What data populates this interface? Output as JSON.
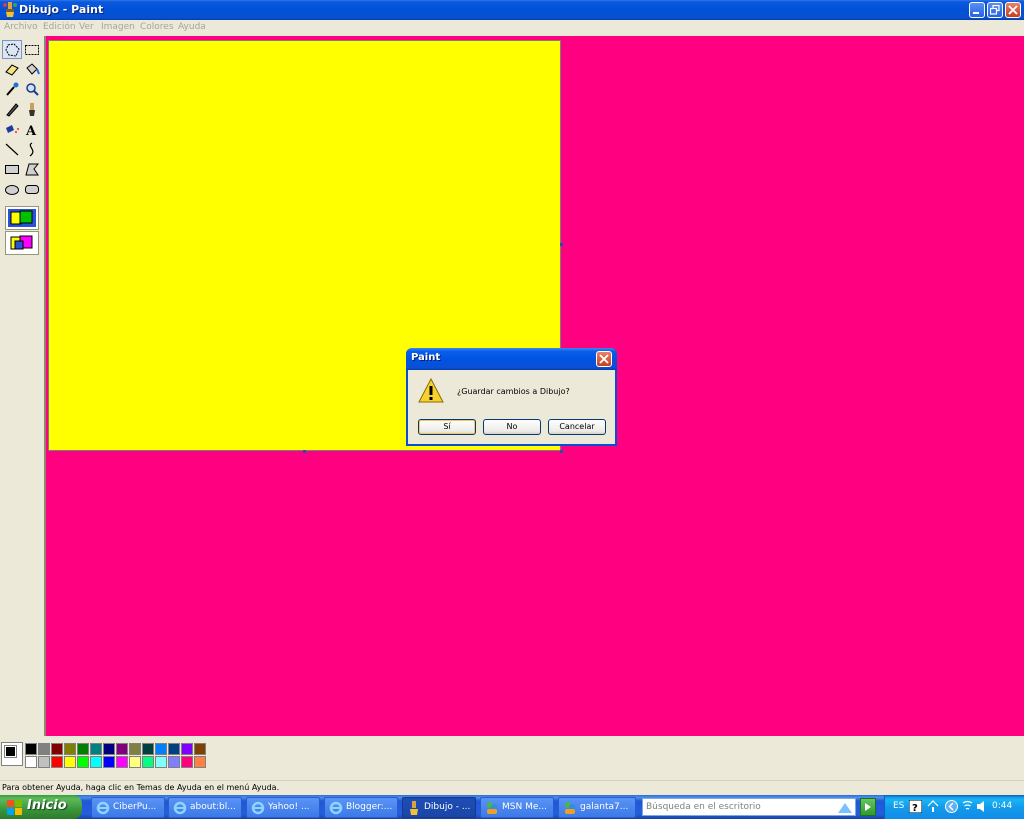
{
  "window": {
    "title": "Dibujo - Paint"
  },
  "menu": [
    "Archivo",
    "Edición",
    "Ver",
    "Imagen",
    "Colores",
    "Ayuda"
  ],
  "tools": [
    "free-select",
    "rect-select",
    "eraser",
    "fill",
    "eyedropper",
    "magnifier",
    "pencil",
    "brush",
    "airbrush",
    "text",
    "line",
    "curve",
    "rectangle",
    "polygon",
    "ellipse",
    "rounded-rectangle"
  ],
  "canvas": {
    "background_color": "#ff0080",
    "image_color": "#ffff00"
  },
  "palette": {
    "foreground": "#000000",
    "background": "#ffffff",
    "row1": [
      "#000000",
      "#808080",
      "#800000",
      "#808000",
      "#008000",
      "#008080",
      "#000080",
      "#800080",
      "#808040",
      "#004040",
      "#0080ff",
      "#004080",
      "#8000ff",
      "#804000"
    ],
    "row2": [
      "#ffffff",
      "#c0c0c0",
      "#ff0000",
      "#ffff00",
      "#00ff00",
      "#00ffff",
      "#0000ff",
      "#ff00ff",
      "#ffff80",
      "#00ff80",
      "#80ffff",
      "#8080ff",
      "#ff0080",
      "#ff8040"
    ]
  },
  "status": {
    "text": "Para obtener Ayuda, haga clic en Temas de Ayuda en el menú Ayuda."
  },
  "dialog": {
    "title": "Paint",
    "message": "¿Guardar cambios a Dibujo?",
    "buttons": {
      "yes": "Sí",
      "no": "No",
      "cancel": "Cancelar"
    }
  },
  "taskbar": {
    "start": "Inicio",
    "tasks": [
      {
        "label": "CiberPu...",
        "icon": "ie-icon"
      },
      {
        "label": "about:bl...",
        "icon": "ie-icon"
      },
      {
        "label": "Yahoo! ...",
        "icon": "ie-icon"
      },
      {
        "label": "Blogger:...",
        "icon": "ie-icon"
      },
      {
        "label": "Dibujo - ...",
        "icon": "paint-icon"
      },
      {
        "label": "MSN Me...",
        "icon": "msn-icon"
      },
      {
        "label": "galanta7...",
        "icon": "msn-icon"
      }
    ],
    "search_placeholder": "Búsqueda en el escritorio",
    "language": "ES",
    "clock": "0:44"
  }
}
